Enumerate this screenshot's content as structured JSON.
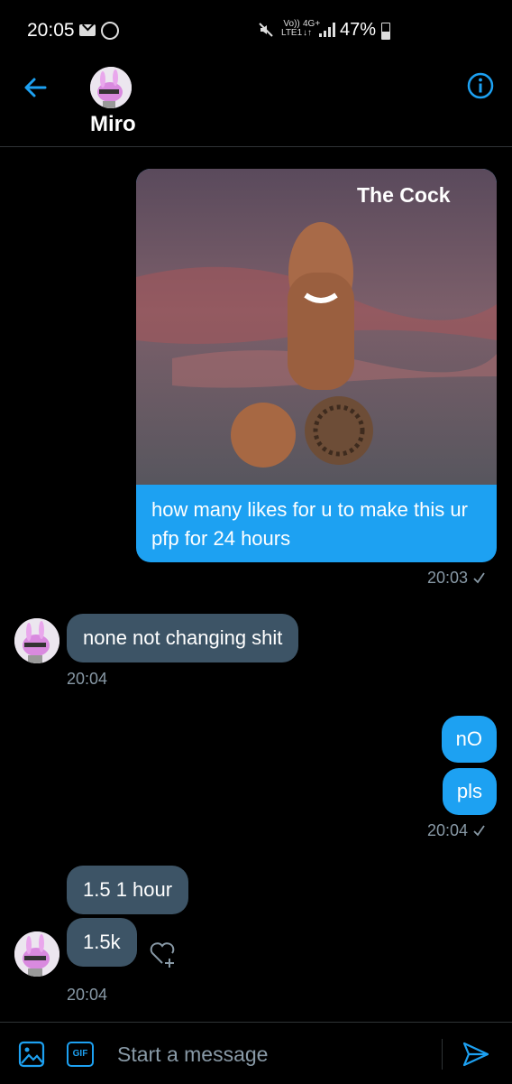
{
  "status_bar": {
    "time": "20:05",
    "volte_top": "Vo))",
    "volte_bottom": "LTE1",
    "network": "4G+",
    "network_arrows": "↓↑",
    "battery": "47%"
  },
  "header": {
    "contact_name": "Miro"
  },
  "messages": {
    "m1": {
      "image_caption": "The Cock",
      "text": "how many likes for u to make this ur pfp for 24 hours",
      "time": "20:03"
    },
    "m2": {
      "text": "none not changing shit",
      "time": "20:04"
    },
    "m3": {
      "text": "nO"
    },
    "m4": {
      "text": "pls",
      "time": "20:04"
    },
    "m5": {
      "text": "1.5 1 hour"
    },
    "m6": {
      "text": "1.5k",
      "time": "20:04"
    }
  },
  "composer": {
    "gif_label": "GIF",
    "placeholder": "Start a message"
  },
  "colors": {
    "accent": "#1da1f2",
    "incoming_bubble": "#3d5466",
    "secondary_text": "#8899a6",
    "background": "#000000"
  }
}
